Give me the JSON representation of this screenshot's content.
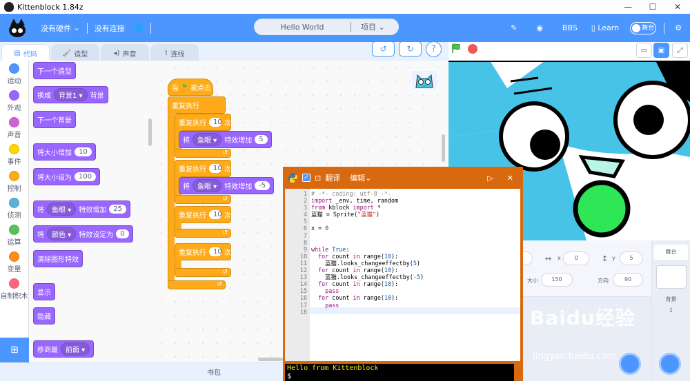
{
  "window": {
    "title": "Kittenblock 1.84z",
    "minimize": "—",
    "maximize": "☐",
    "close": "✕"
  },
  "menubar": {
    "hardware": "没有硬件",
    "connection": "没有连接",
    "project_title": "Hello World",
    "project_menu": "项目",
    "bbs": "BBS",
    "learn": "Learn",
    "stage_toggle": "舞台"
  },
  "tabs": [
    {
      "label": "代码",
      "icon": "code-icon"
    },
    {
      "label": "造型",
      "icon": "brush-icon"
    },
    {
      "label": "声音",
      "icon": "speaker-icon"
    },
    {
      "label": "连线",
      "icon": "wire-icon"
    }
  ],
  "categories": [
    {
      "label": "运动",
      "color": "#4c97ff"
    },
    {
      "label": "外观",
      "color": "#9966ff"
    },
    {
      "label": "声音",
      "color": "#cf63cf"
    },
    {
      "label": "事件",
      "color": "#ffd500"
    },
    {
      "label": "控制",
      "color": "#ffab19"
    },
    {
      "label": "侦测",
      "color": "#5cb1d6"
    },
    {
      "label": "运算",
      "color": "#59c059"
    },
    {
      "label": "变量",
      "color": "#ff8c1a"
    },
    {
      "label": "自制积木",
      "color": "#ff6680"
    }
  ],
  "palette": {
    "next_costume": "下一个造型",
    "switch_backdrop": "换成",
    "switch_backdrop_val": "背景1",
    "switch_backdrop_tail": "背景",
    "next_backdrop": "下一个背景",
    "change_size": "将大小增加",
    "change_size_val": "10",
    "set_size": "将大小设为",
    "set_size_val": "100",
    "change_effect_pre": "将",
    "change_effect_dd": "鱼眼",
    "change_effect": "特效增加",
    "change_effect_val": "25",
    "set_effect_pre": "将",
    "set_effect_dd": "颜色",
    "set_effect": "特效设定为",
    "set_effect_val": "0",
    "clear_effects": "清除图形特效",
    "show": "显示",
    "hide": "隐藏",
    "go_layer": "移到最",
    "go_layer_dd": "前面"
  },
  "script": {
    "hat_when": "当",
    "hat_clicked": "被点击",
    "forever": "重复执行",
    "repeat": "重复执行",
    "times": "次",
    "r1": "10",
    "r2": "10",
    "r3": "10",
    "r4": "10",
    "b1_pre": "将",
    "b1_dd": "鱼眼",
    "b1_mid": "特效增加",
    "b1_val": "5",
    "b2_pre": "将",
    "b2_dd": "鱼眼",
    "b2_mid": "特效增加",
    "b2_val": "-5"
  },
  "python_panel": {
    "translate": "翻译",
    "edit": "编辑",
    "close": "✕",
    "line_numbers": [
      "1",
      "2",
      "3",
      "4",
      "5",
      "6",
      "7",
      "8",
      "9",
      "10",
      "11",
      "12",
      "13",
      "14",
      "15",
      "16",
      "17",
      "18"
    ],
    "console_output": "Hello from Kittenblock",
    "console_prompt": "$"
  },
  "sprite_info": {
    "x_label": "x",
    "x_val": "0",
    "y_label": "y",
    "y_val": "5",
    "size_label": "大小",
    "size_val": "150",
    "dir_label": "方向",
    "dir_val": "90"
  },
  "stage_panel": {
    "label": "舞台",
    "backdrops_label": "背景",
    "backdrops_count": "1"
  },
  "bottom": {
    "backpack": "书包"
  },
  "watermark": {
    "brand": "Baidu经验",
    "url": "jingyan.baidu.com"
  }
}
